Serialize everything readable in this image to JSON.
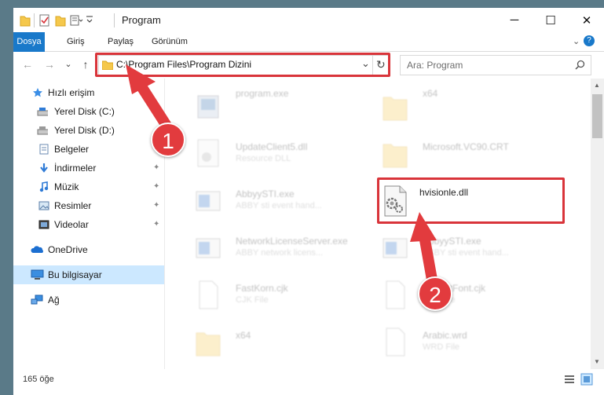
{
  "window": {
    "title": "Program",
    "controls": {
      "minimize": "─",
      "maximize": "☐",
      "close": "✕"
    }
  },
  "ribbon": {
    "tabs": [
      "Dosya",
      "Giriş",
      "Paylaş",
      "Görünüm"
    ],
    "expand": "⌄",
    "help": "?"
  },
  "navbar": {
    "back": "←",
    "forward": "→",
    "recent": "⌄",
    "up": "↑",
    "address": "C:\\Program Files\\Program Dizini",
    "dropdown": "⌄",
    "refresh": "↻",
    "search_placeholder": "Ara: Program"
  },
  "sidebar": {
    "items": [
      {
        "label": "Hızlı erişim",
        "icon": "star-icon"
      },
      {
        "label": "Yerel Disk (C:)",
        "icon": "drive-icon"
      },
      {
        "label": "Yerel Disk (D:)",
        "icon": "drive-icon"
      },
      {
        "label": "Belgeler",
        "icon": "documents-icon"
      },
      {
        "label": "İndirmeler",
        "icon": "download-icon"
      },
      {
        "label": "Müzik",
        "icon": "music-icon"
      },
      {
        "label": "Resimler",
        "icon": "pictures-icon"
      },
      {
        "label": "Videolar",
        "icon": "videos-icon"
      },
      {
        "label": "OneDrive",
        "icon": "onedrive-icon"
      },
      {
        "label": "Bu bilgisayar",
        "icon": "computer-icon"
      },
      {
        "label": "Ağ",
        "icon": "network-icon"
      }
    ],
    "pin": "📌"
  },
  "files": [
    {
      "name": "program.exe",
      "type": ""
    },
    {
      "name": "x64",
      "type": ""
    },
    {
      "name": "UpdateClient5.dll",
      "type": "Resource DLL"
    },
    {
      "name": "Microsoft.VC90.CRT",
      "type": ""
    },
    {
      "name": "AbbyySTI.exe",
      "type": "ABBY sti event hand..."
    },
    {
      "name": "hvisionle.dll",
      "type": ""
    },
    {
      "name": "NetworkLicenseServer.exe",
      "type": "ABBY network licens..."
    },
    {
      "name": "AbbyySTI.exe",
      "type": "ABBY sti event hand..."
    },
    {
      "name": "FastKorn.cjk",
      "type": "CJK File"
    },
    {
      "name": "DefaultFont.cjk",
      "type": "CJK File"
    },
    {
      "name": "x64",
      "type": ""
    },
    {
      "name": "Arabic.wrd",
      "type": "WRD File"
    }
  ],
  "status": {
    "count": "165 öğe"
  },
  "annotations": {
    "step1": "1",
    "step2": "2"
  },
  "colors": {
    "accent": "#1979ca",
    "annotation": "#e23b3e",
    "selection": "#cce8ff"
  }
}
